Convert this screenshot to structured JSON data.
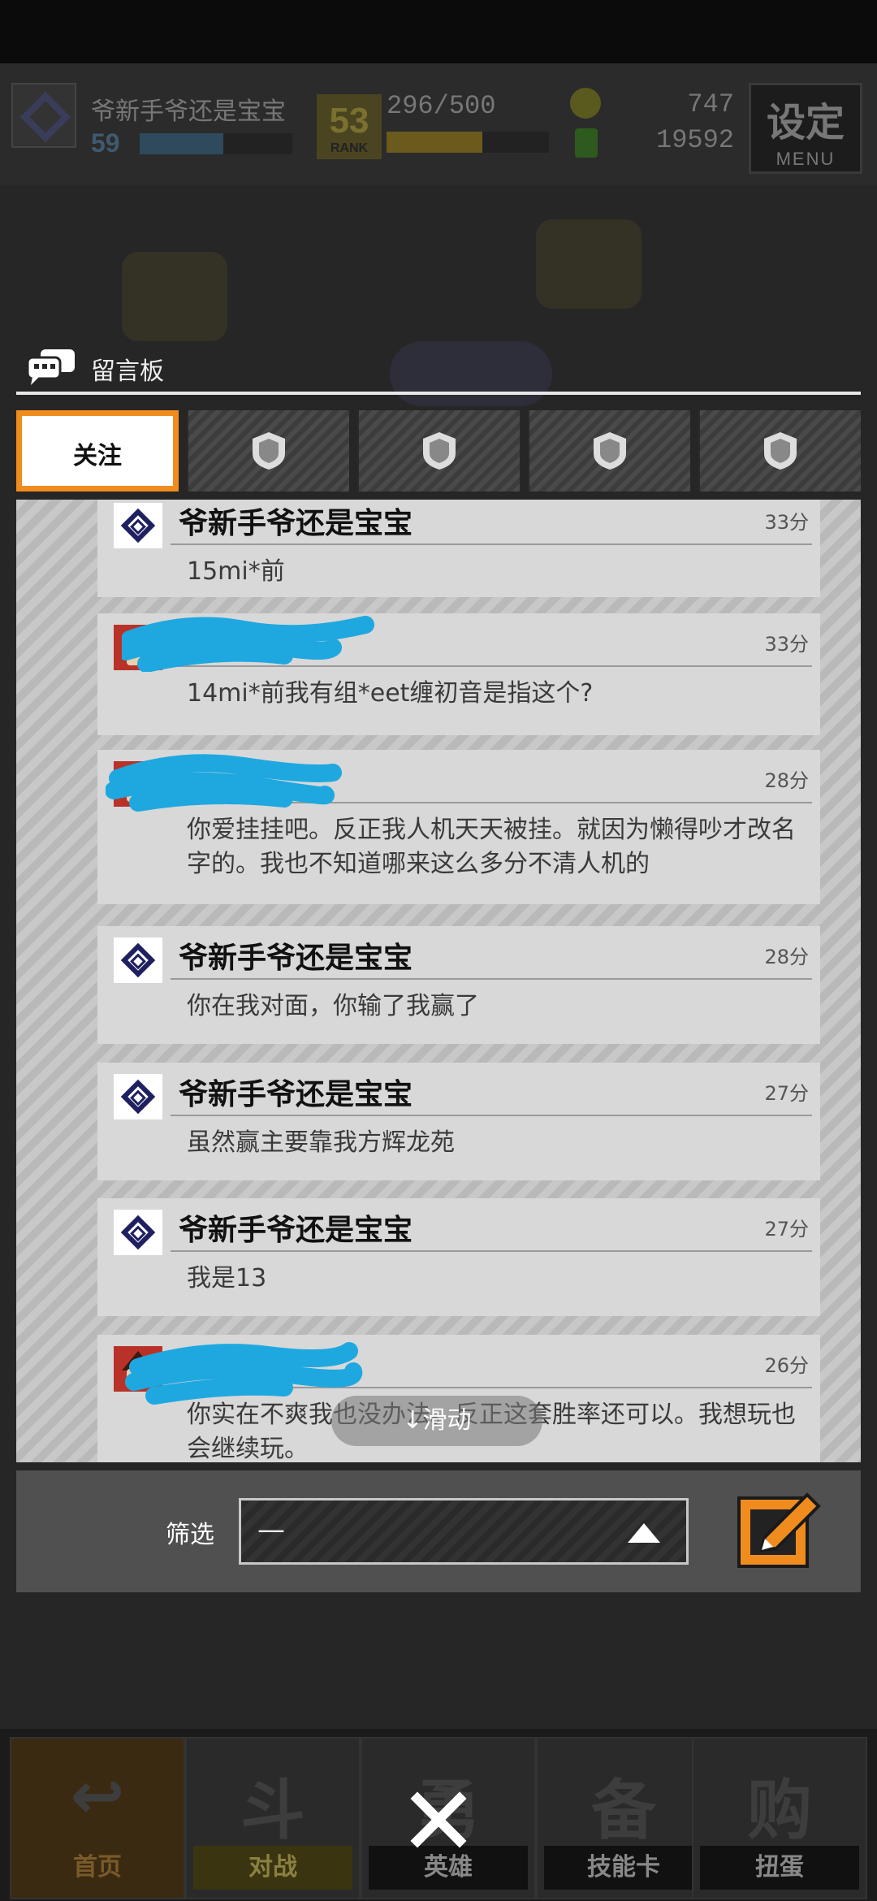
{
  "hud": {
    "player_name": "爷新手爷还是宝宝",
    "level": "59",
    "xp_fill": 0.55,
    "rank_number": "53",
    "rank_label": "RANK",
    "rank_progress": "296/500",
    "rank_fill": 0.59,
    "coins": "747",
    "gems": "19592",
    "menu_title": "设定",
    "menu_label": "MENU"
  },
  "board": {
    "title": "留言板"
  },
  "tabs": [
    {
      "label": "关注",
      "active": true
    },
    {
      "label": "",
      "icon": "shield-icon"
    },
    {
      "label": "",
      "icon": "shield-icon"
    },
    {
      "label": "",
      "icon": "shield-icon"
    },
    {
      "label": "",
      "icon": "shield-icon"
    }
  ],
  "messages": [
    {
      "user": "爷新手爷还是宝宝",
      "time": "33分",
      "body": "15mi*前",
      "avatar": "logo"
    },
    {
      "user": "",
      "time": "33分",
      "body": "14mi*前我有组*eet缠初音是指这个?",
      "avatar": "red",
      "redacted": true
    },
    {
      "user": "",
      "time": "28分",
      "body": "你爱挂挂吧。反正我人机天天被挂。就因为懒得吵才改名字的。我也不知道哪来这么多分不清人机的",
      "avatar": "red",
      "redacted": true
    },
    {
      "user": "爷新手爷还是宝宝",
      "time": "28分",
      "body": "你在我对面，你输了我赢了",
      "avatar": "logo"
    },
    {
      "user": "爷新手爷还是宝宝",
      "time": "27分",
      "body": "虽然赢主要靠我方辉龙苑",
      "avatar": "logo"
    },
    {
      "user": "爷新手爷还是宝宝",
      "time": "27分",
      "body": "我是13",
      "avatar": "logo"
    },
    {
      "user": "",
      "time": "26分",
      "body": "你实在不爽我也没办法。反正这套胜率还可以。我想玩也会继续玩。",
      "avatar": "red",
      "redacted": true
    }
  ],
  "scroll_hint": "↓滑动",
  "filter": {
    "label": "筛选",
    "value": "—"
  },
  "nav": [
    {
      "label": "首页",
      "glyph": "↩"
    },
    {
      "label": "对战",
      "glyph": "斗"
    },
    {
      "label": "英雄",
      "glyph": "勇"
    },
    {
      "label": "技能卡",
      "glyph": "备"
    },
    {
      "label": "扭蛋",
      "glyph": "购"
    }
  ],
  "colors": {
    "accent_orange": "#f08c1e",
    "redaction_blue": "#1fa8e0"
  }
}
